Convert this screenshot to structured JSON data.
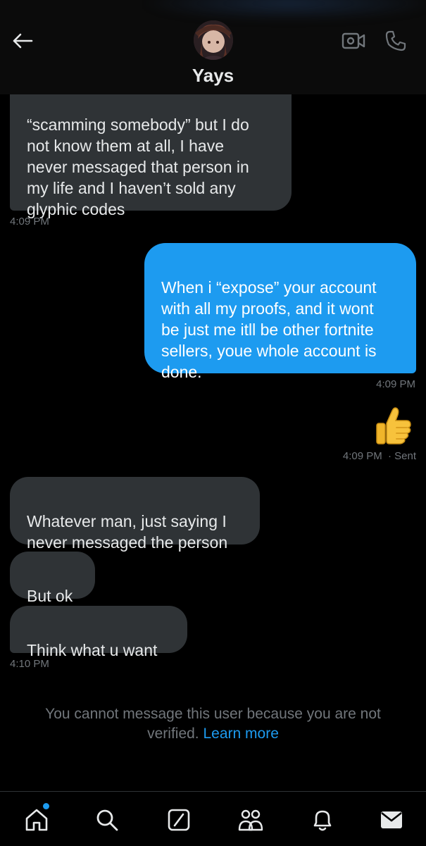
{
  "header": {
    "name": "Yays",
    "back_icon": "arrow-left-icon",
    "video_icon": "video-camera-icon",
    "call_icon": "phone-icon"
  },
  "messages": [
    {
      "type": "received",
      "text": "“scamming somebody” but I do\nnot know them at all, I have\nnever messaged that person in\nmy life and I haven’t sold any\nglyphic codes",
      "time": "4:09 PM"
    },
    {
      "type": "sent",
      "text": "When i “expose” your account\nwith all my proofs, and it wont\nbe just me itll be other fortnite\nsellers, youe whole account is\ndone.",
      "time": "4:09 PM"
    },
    {
      "type": "sent-emoji",
      "emoji": "👍",
      "time": "4:09 PM",
      "status": "· Sent"
    },
    {
      "type": "received",
      "text": "Whatever man, just saying I\nnever messaged the person"
    },
    {
      "type": "received",
      "text": "But ok"
    },
    {
      "type": "received",
      "text": "Think what u want",
      "time": "4:10 PM"
    }
  ],
  "notice": {
    "text": "You cannot message this user because you are not verified.",
    "link": "Learn more"
  },
  "nav": [
    "home-icon",
    "search-icon",
    "grok-icon",
    "communities-icon",
    "notifications-icon",
    "messages-icon"
  ],
  "colors": {
    "accent": "#1d9bf0",
    "received_bubble": "#2f3336",
    "background": "#000000",
    "muted": "#71767b"
  }
}
